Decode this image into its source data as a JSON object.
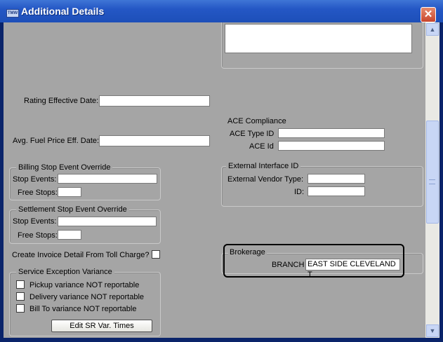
{
  "window": {
    "title": "Additional Details",
    "title_icon_text": "TMW",
    "close_glyph": "✕"
  },
  "left": {
    "rating_effective_date_label": "Rating Effective Date:",
    "rating_effective_date_value": "",
    "avg_fuel_price_label": "Avg. Fuel Price Eff. Date:",
    "avg_fuel_price_value": "",
    "billing_group": {
      "title": "Billing Stop Event Override",
      "stop_events_label": "Stop Events:",
      "free_stops_label": "Free Stops:"
    },
    "settlement_group": {
      "title": "Settlement Stop Event Override",
      "stop_events_label": "Stop Events:",
      "free_stops_label": "Free Stops:"
    },
    "create_invoice_label": "Create Invoice Detail From Toll Charge?",
    "service_exception": {
      "title": "Service Exception Variance",
      "items": [
        "Pickup variance NOT reportable",
        "Delivery variance NOT reportable",
        "Bill To variance NOT reportable"
      ],
      "button_label": "Edit SR Var. Times"
    }
  },
  "right": {
    "ace": {
      "title": "ACE Compliance",
      "type_id_label": "ACE Type ID",
      "id_label": "ACE Id"
    },
    "external": {
      "title": "External Interface ID",
      "vendor_type_label": "External Vendor Type:",
      "id_label": "ID:"
    },
    "brokerage": {
      "title": "Brokerage",
      "branch_label": "BRANCH",
      "branch_value": "EAST SIDE CLEVELAND T"
    }
  },
  "colors": {
    "title_bar": "#2457c5",
    "client_bg": "#a5a5a5",
    "close_button": "#c8452d"
  },
  "scrollbar": {
    "up_glyph": "▲",
    "down_glyph": "▼"
  }
}
